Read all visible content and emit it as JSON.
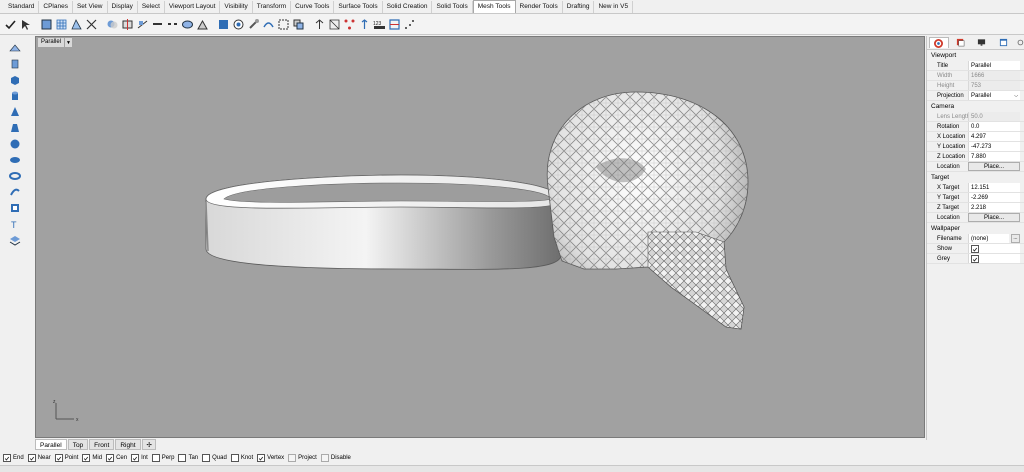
{
  "tabs": [
    "Standard",
    "CPlanes",
    "Set View",
    "Display",
    "Select",
    "Viewport Layout",
    "Visibility",
    "Transform",
    "Curve Tools",
    "Surface Tools",
    "Solid Creation",
    "Solid Tools",
    "Mesh Tools",
    "Render Tools",
    "Drafting",
    "New in V5"
  ],
  "active_tab": "Mesh Tools",
  "viewport": {
    "title": "Parallel",
    "tabs": [
      "Parallel",
      "Top",
      "Front",
      "Right"
    ],
    "active": "Parallel",
    "axis_x": "x",
    "axis_z": "z"
  },
  "osnaps": [
    {
      "label": "End",
      "checked": true
    },
    {
      "label": "Near",
      "checked": true
    },
    {
      "label": "Point",
      "checked": true
    },
    {
      "label": "Mid",
      "checked": true
    },
    {
      "label": "Cen",
      "checked": true
    },
    {
      "label": "Int",
      "checked": true
    },
    {
      "label": "Perp",
      "checked": false
    },
    {
      "label": "Tan",
      "checked": false
    },
    {
      "label": "Quad",
      "checked": false
    },
    {
      "label": "Knot",
      "checked": false
    },
    {
      "label": "Vertex",
      "checked": true
    },
    {
      "label": "Project",
      "checked": false
    },
    {
      "label": "Disable",
      "checked": false
    }
  ],
  "properties": {
    "viewport_header": "Viewport",
    "title_label": "Title",
    "title_value": "Parallel",
    "width_label": "Width",
    "width_value": "1666",
    "height_label": "Height",
    "height_value": "753",
    "projection_label": "Projection",
    "projection_value": "Parallel",
    "camera_header": "Camera",
    "lens_label": "Lens Length",
    "lens_value": "50.0",
    "rotation_label": "Rotation",
    "rotation_value": "0.0",
    "xloc_label": "X Location",
    "xloc_value": "4.297",
    "yloc_label": "Y Location",
    "yloc_value": "-47.273",
    "zloc_label": "Z Location",
    "zloc_value": "7.880",
    "location_label": "Location",
    "place_button": "Place...",
    "target_header": "Target",
    "xt_label": "X Target",
    "xt_value": "12.151",
    "yt_label": "Y Target",
    "yt_value": "-2.269",
    "zt_label": "Z Target",
    "zt_value": "2.218",
    "tlocation_label": "Location",
    "tplace_button": "Place...",
    "wallpaper_header": "Wallpaper",
    "filename_label": "Filename",
    "filename_value": "(none)",
    "browse_button": "...",
    "show_label": "Show",
    "show_checked": true,
    "grey_label": "Grey",
    "grey_checked": true
  },
  "colors": {
    "viewport_bg": "#a1a1a1",
    "accent_blue": "#2f6db5"
  }
}
